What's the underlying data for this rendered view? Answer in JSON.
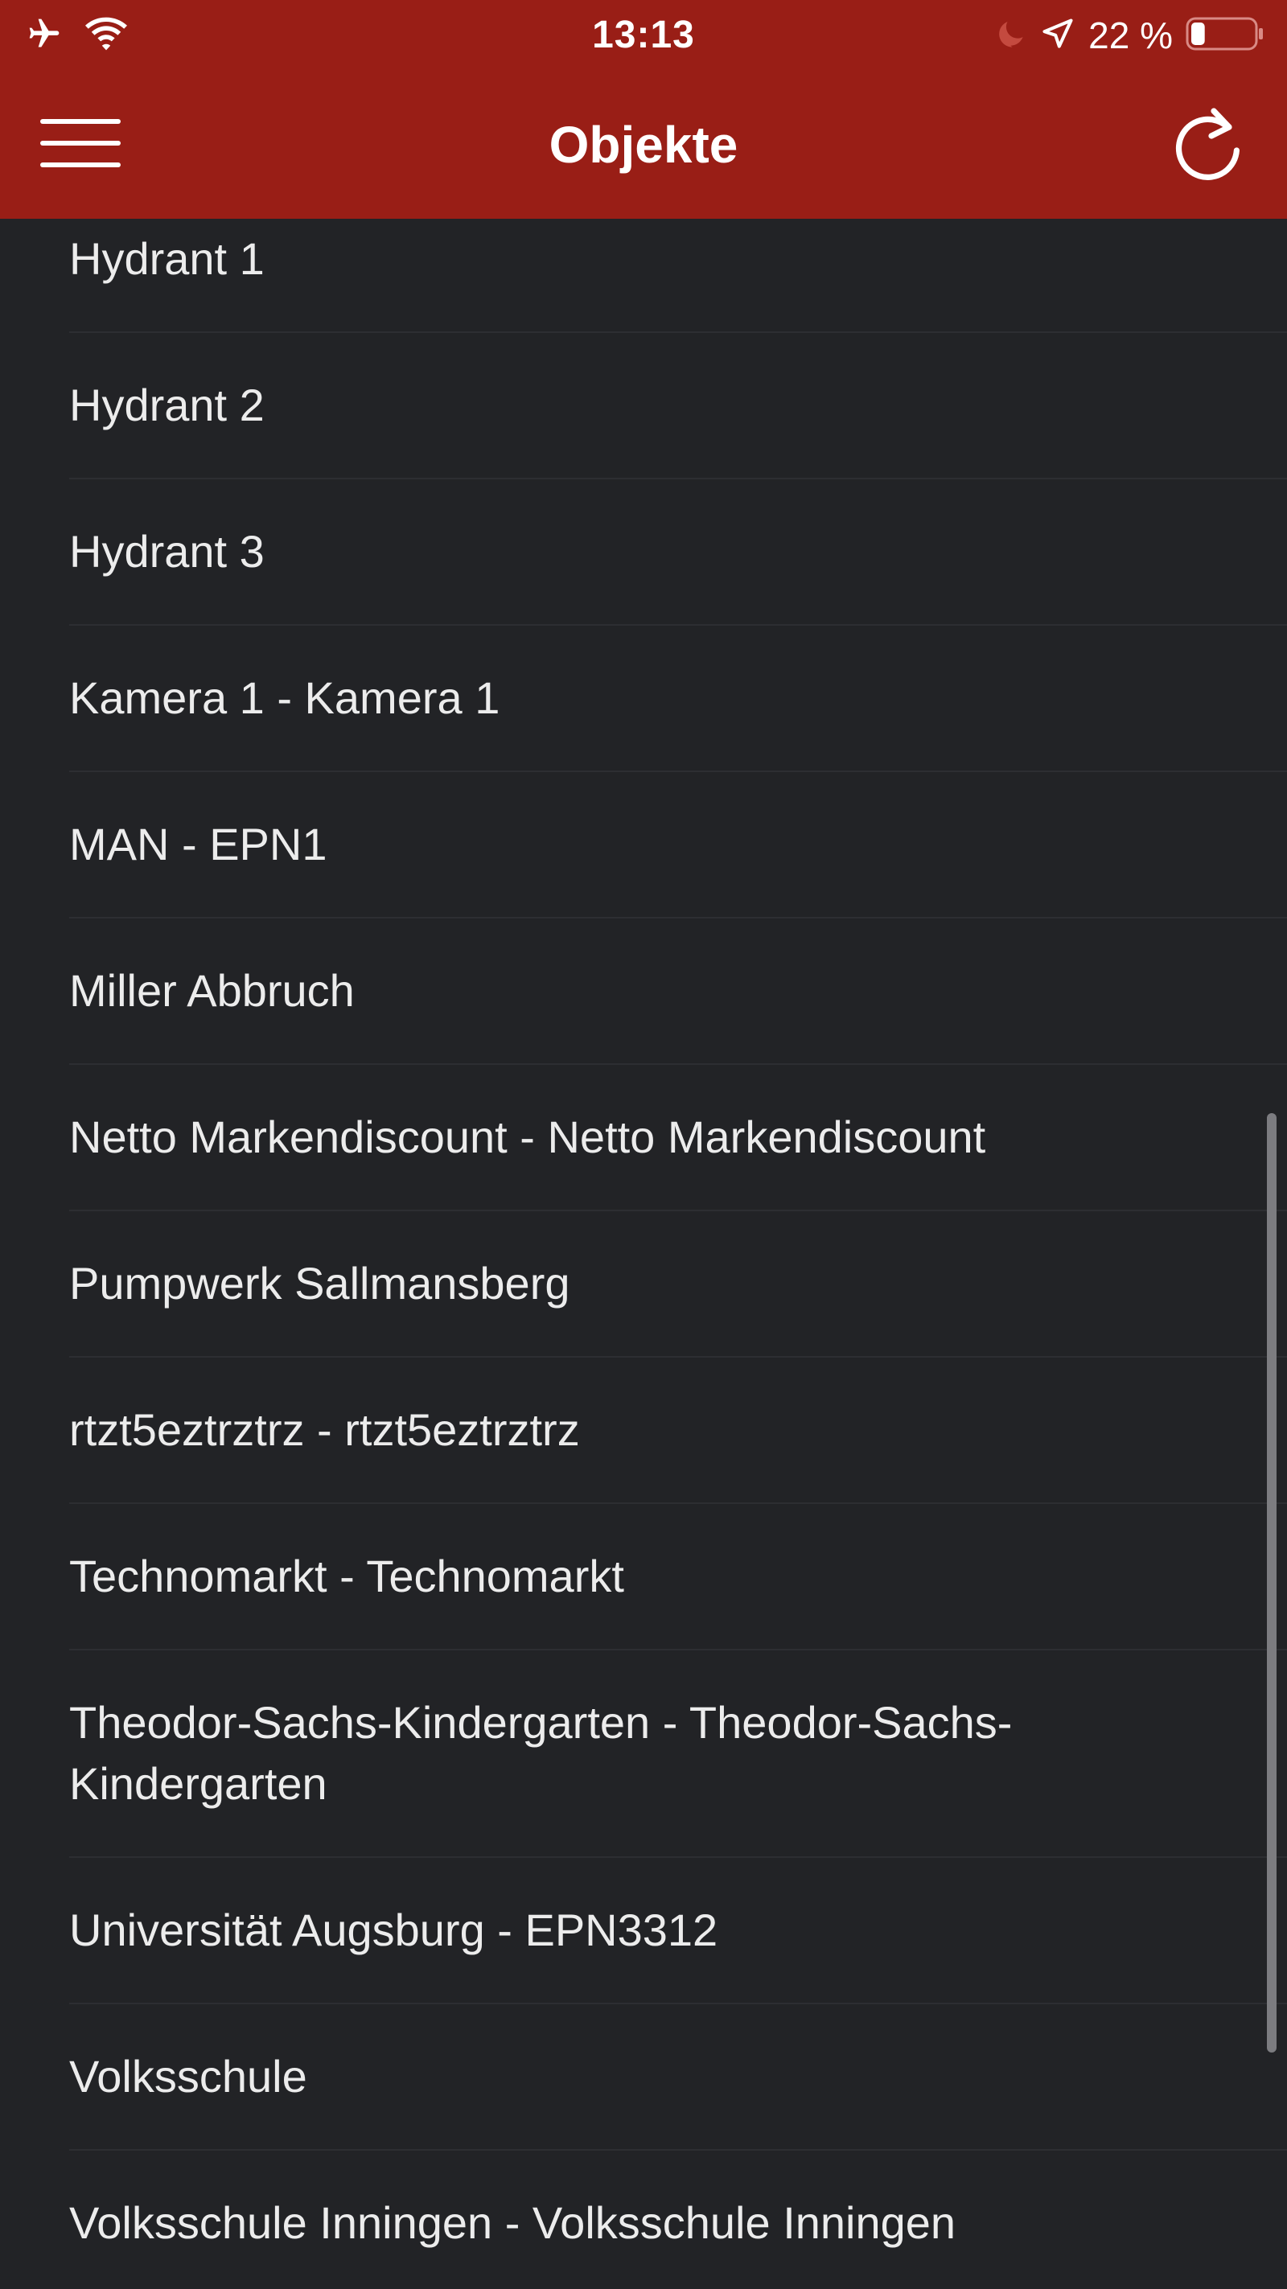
{
  "status_bar": {
    "time": "13:13",
    "battery_text": "22 %",
    "battery_level": 0.22
  },
  "icons": {
    "airplane": "airplane-mode-icon",
    "wifi": "wifi-icon",
    "moon": "do-not-disturb-icon",
    "location": "location-arrow-icon",
    "battery": "battery-icon",
    "menu": "hamburger-menu-icon",
    "refresh": "refresh-icon"
  },
  "colors": {
    "header": "#991e16",
    "background": "#222326",
    "text": "#ececec",
    "separator": "#2d2e32"
  },
  "header": {
    "title": "Objekte"
  },
  "objects": [
    "Hydrant 1",
    "Hydrant 2",
    "Hydrant 3",
    "Kamera 1 - Kamera 1",
    "MAN - EPN1",
    "Miller Abbruch",
    "Netto Markendiscount - Netto Markendiscount",
    "Pumpwerk Sallmansberg",
    "rtzt5eztrztrz - rtzt5eztrztrz",
    "Technomarkt - Technomarkt",
    "Theodor-Sachs-Kindergarten - Theodor-Sachs-Kindergarten",
    "Universität Augsburg - EPN3312",
    "Volksschule",
    "Volksschule Inningen - Volksschule Inningen"
  ]
}
